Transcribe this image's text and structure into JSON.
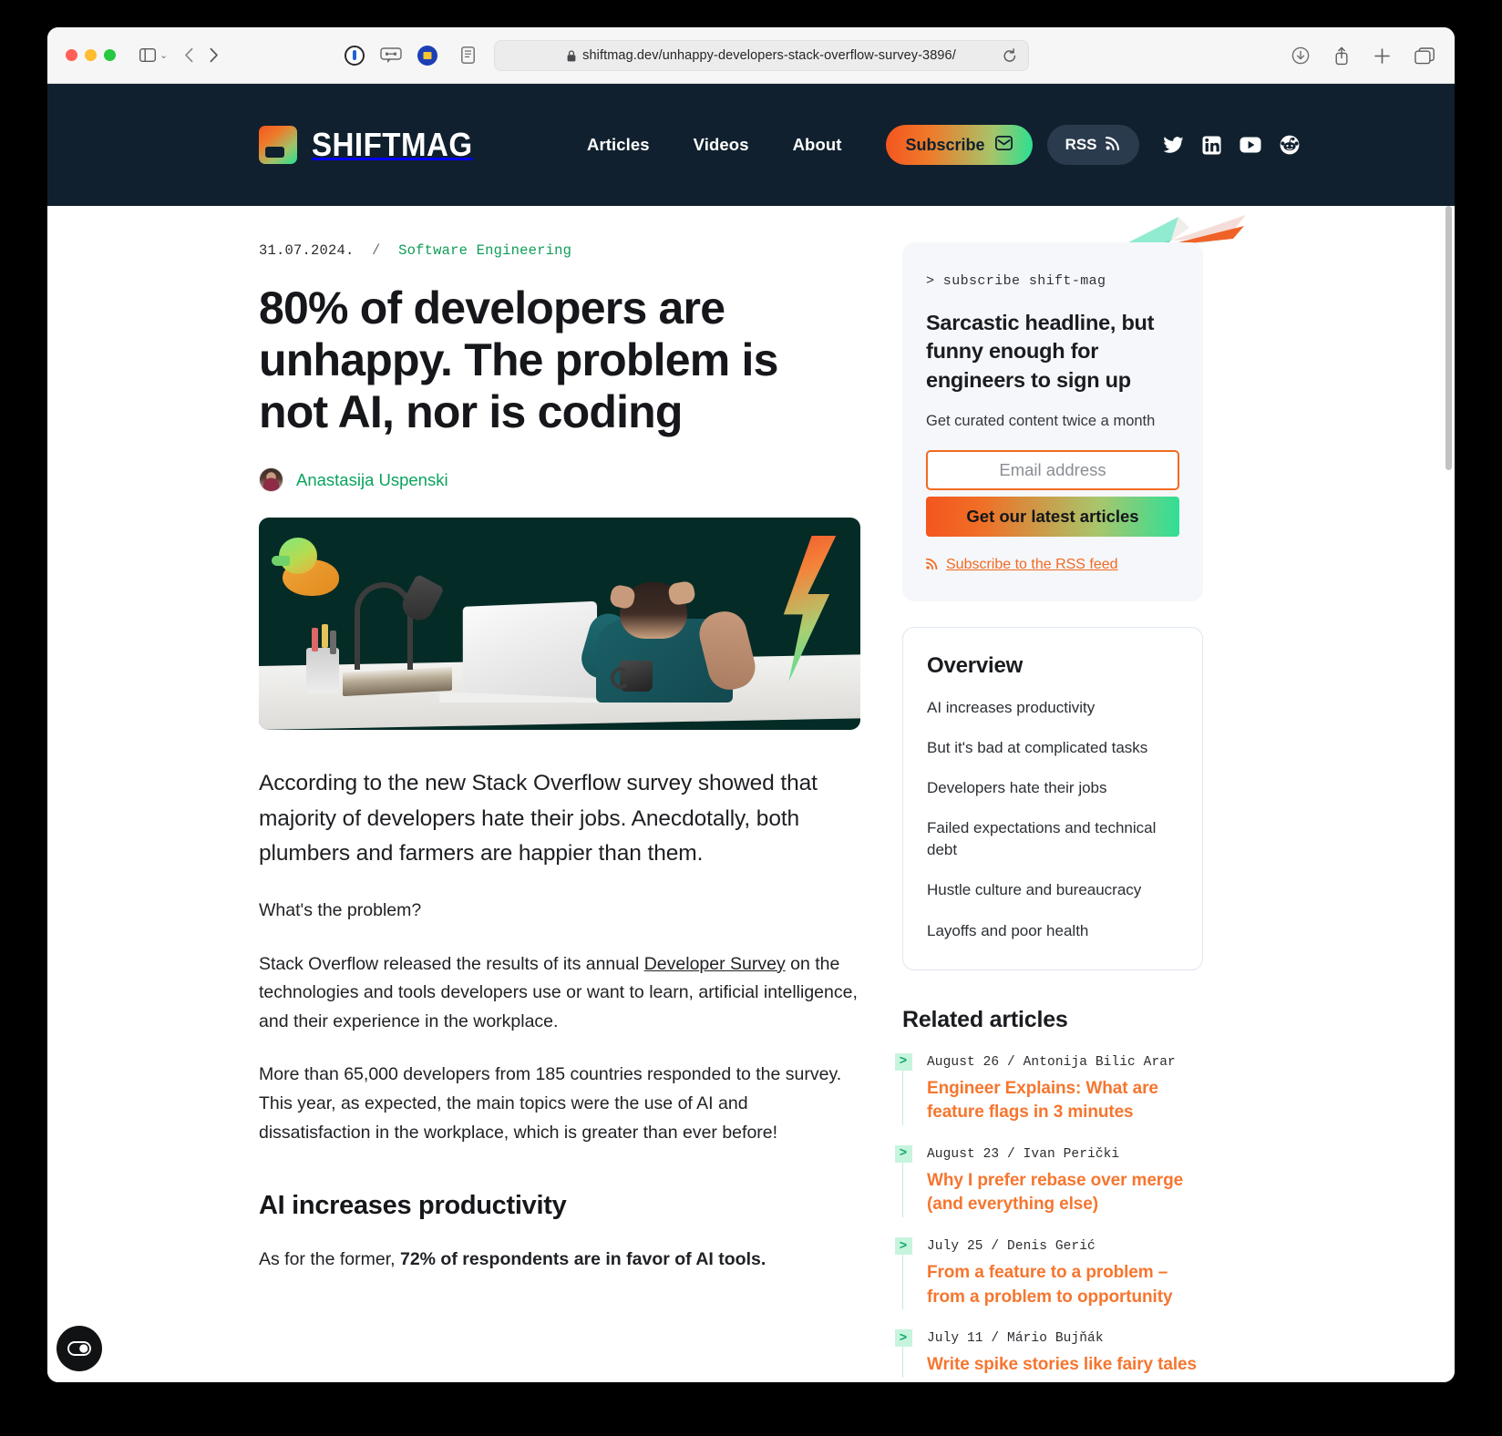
{
  "browser": {
    "url": "shiftmag.dev/unhappy-developers-stack-overflow-survey-3896/",
    "icons": {
      "sidebar": "sidebar-icon",
      "chevron": "chevron-down-icon",
      "back": "back-arrow-icon",
      "forward": "forward-arrow-icon",
      "onepassword": "1password-icon",
      "extension": "extension-icon",
      "privacy": "privacy-badge-icon",
      "reader": "reader-view-icon",
      "lock": "lock-icon",
      "reload": "reload-icon",
      "download": "download-icon",
      "share": "share-icon",
      "newtab": "plus-icon",
      "tabs": "tab-overview-icon"
    }
  },
  "site": {
    "logo_text": "SHIFTMAG",
    "nav": [
      {
        "label": "Articles"
      },
      {
        "label": "Videos"
      },
      {
        "label": "About"
      }
    ],
    "subscribe_label": "Subscribe",
    "rss_label": "RSS",
    "social": [
      {
        "name": "twitter-icon"
      },
      {
        "name": "linkedin-icon"
      },
      {
        "name": "youtube-icon"
      },
      {
        "name": "reddit-icon"
      }
    ]
  },
  "article": {
    "date": "31.07.2024.",
    "separator": "/",
    "category": "Software Engineering",
    "title": "80% of developers are unhappy. The problem is not AI, nor is coding",
    "author": "Anastasija Uspenski",
    "lede": "According to the new Stack Overflow survey showed that majority of developers hate their jobs. Anecdotally, both plumbers and farmers are happier than them.",
    "p1": "What's the problem?",
    "p2_a": "Stack Overflow released the results of its annual ",
    "p2_link": "Developer Survey",
    "p2_b": " on the technologies and tools developers use or want to learn, artificial intelligence, and their experience in the workplace.",
    "p3": "More than 65,000 developers from 185 countries responded to the survey. This year, as expected, the main topics were the use of AI and dissatisfaction in the workplace, which is greater than ever before!",
    "section_heading": "AI increases productivity",
    "p4_a": "As for the former, ",
    "p4_bold": "72% of respondents are in favor of AI tools."
  },
  "subscribe_card": {
    "prompt": "> subscribe shift-mag",
    "headline": "Sarcastic headline, but funny enough for engineers to sign up",
    "subtitle": "Get curated content twice a month",
    "email_placeholder": "Email address",
    "email_value": "",
    "submit_label": "Get our latest articles",
    "rss_link_label": "Subscribe to the RSS feed",
    "accent_orange": "#f26a21",
    "accent_green": "#2fdf96"
  },
  "overview": {
    "title": "Overview",
    "items": [
      {
        "label": "AI increases productivity"
      },
      {
        "label": "But it's bad at complicated tasks"
      },
      {
        "label": "Developers hate their jobs"
      },
      {
        "label": "Failed expectations and technical debt"
      },
      {
        "label": "Hustle culture and bureaucracy"
      },
      {
        "label": "Layoffs and poor health"
      }
    ]
  },
  "related": {
    "title": "Related articles",
    "items": [
      {
        "meta": "August 26 / Antonija Bilic Arar",
        "title": "Engineer Explains: What are feature flags in 3 minutes"
      },
      {
        "meta": "August 23 / Ivan Perički",
        "title": "Why I prefer rebase over merge (and everything else)"
      },
      {
        "meta": "July 25 / Denis Gerić",
        "title": "From a feature to a problem – from a problem to opportunity"
      },
      {
        "meta": "July 11 / Mário Bujňák",
        "title": "Write spike stories like fairy tales"
      }
    ]
  },
  "widgets": {
    "cookie_button": "cookie-consent-icon"
  }
}
